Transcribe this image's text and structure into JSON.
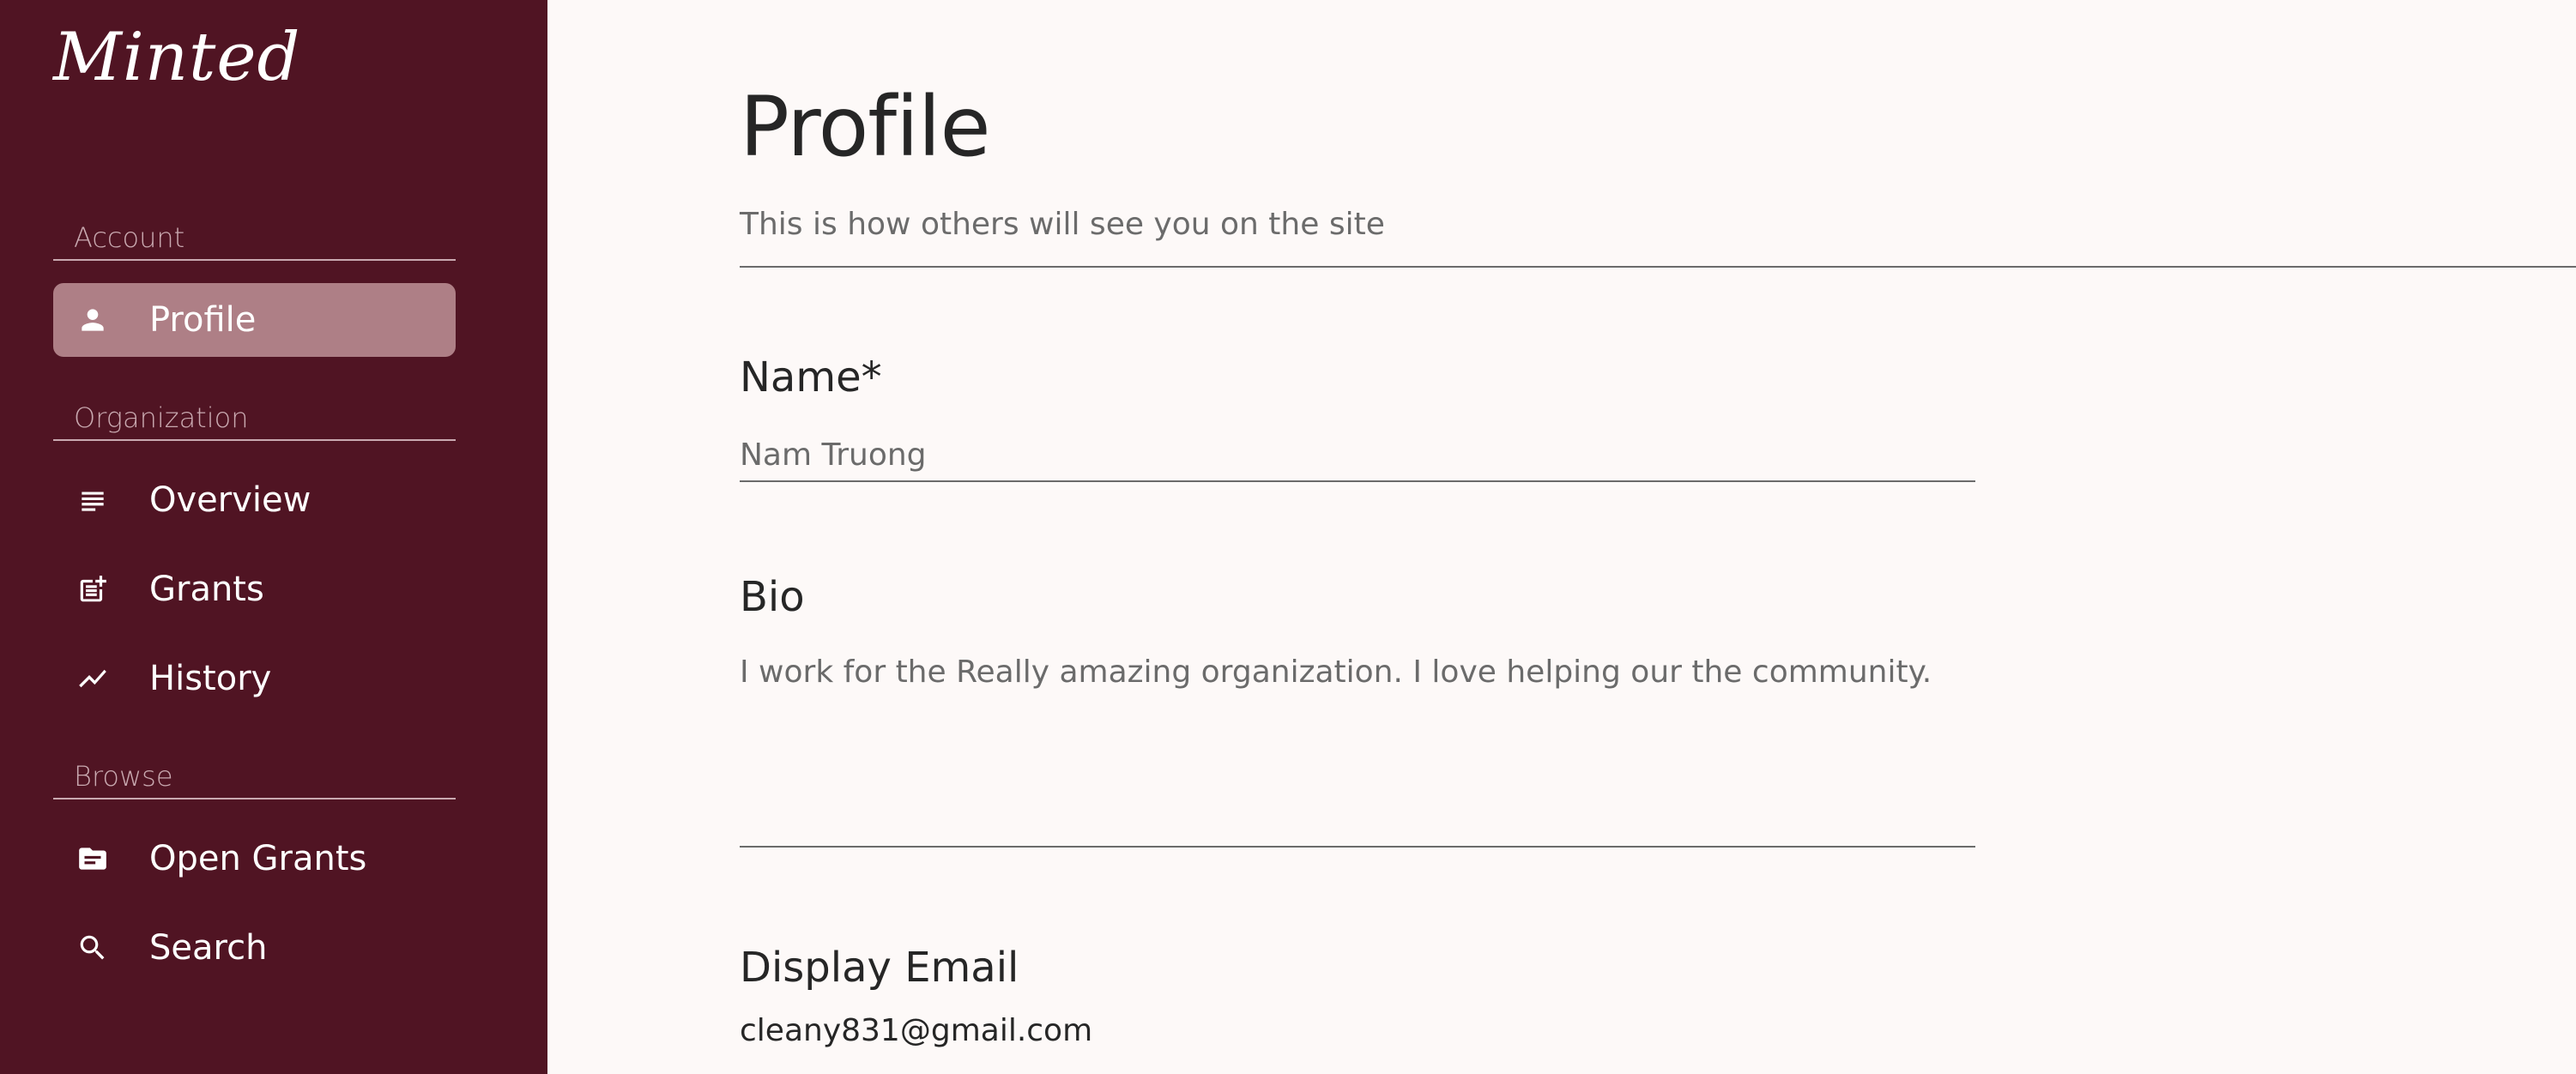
{
  "app": {
    "logo": "Minted"
  },
  "sidebar": {
    "sections": [
      {
        "label": "Account"
      },
      {
        "label": "Organization"
      },
      {
        "label": "Browse"
      }
    ],
    "items": [
      {
        "label": "Profile",
        "icon": "person-icon",
        "active": true
      },
      {
        "label": "Overview",
        "icon": "list-icon",
        "active": false
      },
      {
        "label": "Grants",
        "icon": "post-add-icon",
        "active": false
      },
      {
        "label": "History",
        "icon": "trending-icon",
        "active": false
      },
      {
        "label": "Open Grants",
        "icon": "folder-icon",
        "active": false
      },
      {
        "label": "Search",
        "icon": "search-icon",
        "active": false
      }
    ]
  },
  "main": {
    "title": "Profile",
    "subtitle": "This is how others will see you on the site",
    "fields": {
      "name": {
        "label": "Name*",
        "value": "Nam Truong"
      },
      "bio": {
        "label": "Bio",
        "value": "I work for the Really amazing organization. I love helping our the community."
      },
      "email": {
        "label": "Display Email",
        "value": "cleany831@gmail.com"
      }
    }
  },
  "colors": {
    "sidebar_bg": "#501423",
    "active_item_bg": "#ae7f86",
    "main_bg": "#fdf9f8",
    "section_label": "#c9a9b0"
  }
}
